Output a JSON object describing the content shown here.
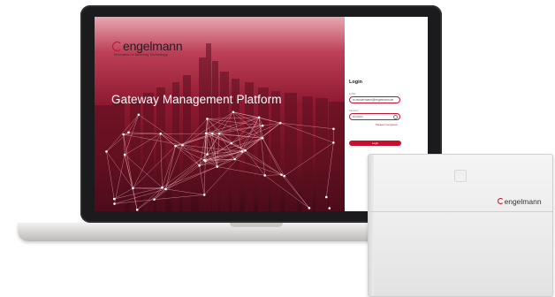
{
  "brand": {
    "name": "engelmann",
    "tagline": "Innovation in Metering Technology",
    "accent_color": "#c8102e"
  },
  "hero": {
    "title": "Gateway Management Platform"
  },
  "login": {
    "title": "Login",
    "username_label": "E-Mail",
    "username_value": "m.mustermann@engelmann.de",
    "password_label": "Passwort",
    "password_value": "••••••••••",
    "forgot_password": "Passwort vergessen",
    "submit_label": "Login"
  },
  "device": {
    "brand": "engelmann"
  }
}
